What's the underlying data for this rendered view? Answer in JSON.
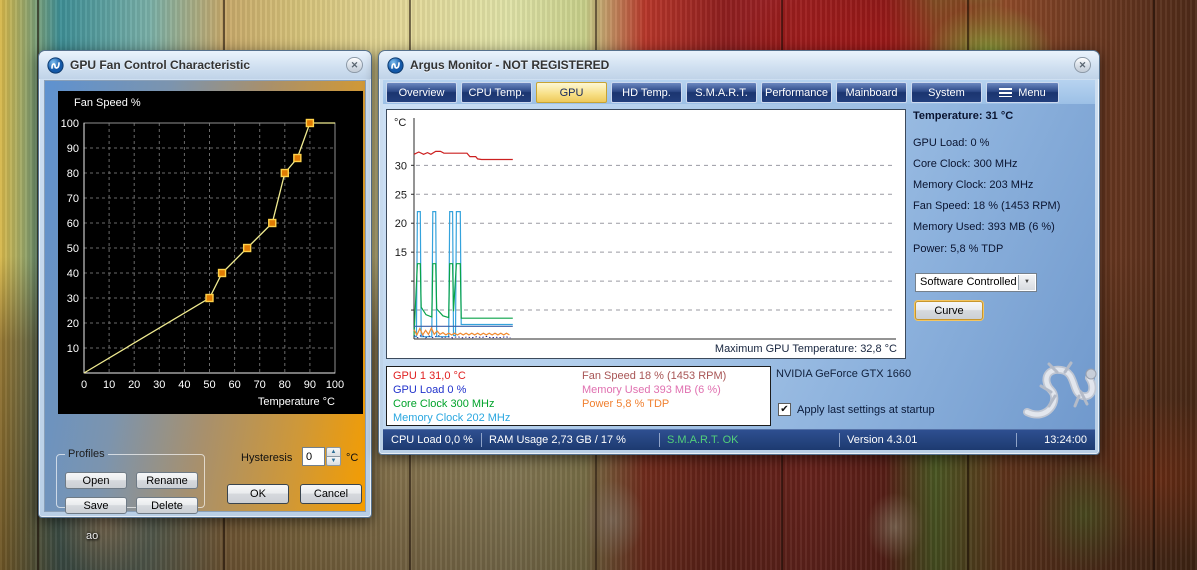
{
  "desktop": {
    "icon_label": "ao"
  },
  "fan_dialog": {
    "title": "GPU Fan Control Characteristic",
    "profiles": {
      "legend": "Profiles",
      "buttons": [
        "Open",
        "Rename",
        "Save",
        "Delete"
      ]
    },
    "hysteresis": {
      "label": "Hysteresis",
      "value": "0",
      "unit": "°C"
    },
    "ok_label": "OK",
    "cancel_label": "Cancel"
  },
  "argus": {
    "title": "Argus Monitor - NOT REGISTERED",
    "tabs": [
      "Overview",
      "CPU Temp.",
      "GPU",
      "HD Temp.",
      "S.M.A.R.T.",
      "Performance",
      "Mainboard",
      "System",
      "Menu"
    ],
    "active_tab": "GPU",
    "info": {
      "rows": [
        "Temperature: 31 °C",
        "GPU Load: 0 %",
        "Core Clock: 300 MHz",
        "Memory Clock: 203 MHz",
        "Fan Speed: 18 % (1453 RPM)",
        "Memory Used: 393 MB (6 %)",
        "Power: 5,8 % TDP"
      ]
    },
    "fan_mode": {
      "value": "Software Controlled"
    },
    "curve_button": "Curve",
    "legend": {
      "col1": [
        {
          "text": "GPU 1 31,0 °C",
          "color": "#e02020"
        },
        {
          "text": "GPU Load 0 %",
          "color": "#2233cc"
        },
        {
          "text": "Core Clock 300 MHz",
          "color": "#00a32a"
        },
        {
          "text": "Memory Clock 202 MHz",
          "color": "#2aa7e0"
        }
      ],
      "col2": [
        {
          "text": "Fan Speed 18 %  (1453 RPM)",
          "color": "#a85555"
        },
        {
          "text": "Memory Used 393 MB  (6 %)",
          "color": "#e070b0"
        },
        {
          "text": "Power 5,8 % TDP",
          "color": "#f08030"
        }
      ]
    },
    "gpu_name": "NVIDIA GeForce GTX 1660",
    "startup_checkbox": {
      "checked": true,
      "label": "Apply last settings at startup"
    },
    "statusbar": {
      "items": [
        "CPU Load 0,0 %",
        "RAM Usage 2,73 GB / 17 %",
        "S.M.A.R.T. OK",
        "Version 4.3.01"
      ],
      "time": "13:24:00"
    }
  },
  "chart_data": [
    {
      "type": "line",
      "title": "GPU fan control characteristic",
      "xlabel": "Temperature °C",
      "ylabel": "Fan Speed %",
      "xlim": [
        0,
        100
      ],
      "ylim": [
        0,
        100
      ],
      "x_ticks": [
        0,
        10,
        20,
        30,
        40,
        50,
        60,
        70,
        80,
        90,
        100
      ],
      "y_ticks": [
        100,
        90,
        80,
        70,
        60,
        50,
        40,
        30,
        20,
        10
      ],
      "grid": true,
      "points": [
        [
          0,
          0
        ],
        [
          50,
          30
        ],
        [
          55,
          40
        ],
        [
          65,
          50
        ],
        [
          75,
          60
        ],
        [
          80,
          80
        ],
        [
          85,
          86
        ],
        [
          90,
          100
        ],
        [
          100,
          100
        ]
      ],
      "marker_points": [
        [
          50,
          30
        ],
        [
          55,
          40
        ],
        [
          65,
          50
        ],
        [
          75,
          60
        ],
        [
          80,
          80
        ],
        [
          85,
          86
        ],
        [
          90,
          100
        ]
      ],
      "line_color": "#f0eb90",
      "marker_fill": "#e07c04",
      "marker_stroke": "#ffd24a"
    },
    {
      "type": "line",
      "title": "GPU history",
      "ylabel": "°C",
      "ylim": [
        0,
        38
      ],
      "gridlines": [
        5,
        10,
        15,
        20,
        25,
        30
      ],
      "y_tick_labels": [
        30,
        25,
        20,
        15
      ],
      "note": "Maximum GPU Temperature: 32,8 °C",
      "x_unit": "percent_of_window",
      "series": [
        {
          "name": "GPU 1 Temperature",
          "color": "#cc2020",
          "points": [
            [
              0,
              31.9
            ],
            [
              1,
              32.3
            ],
            [
              2,
              31.9
            ],
            [
              2.8,
              32.2
            ],
            [
              3.5,
              31.9
            ],
            [
              4.5,
              32.4
            ],
            [
              5.5,
              32.4
            ],
            [
              6.2,
              32.1
            ],
            [
              8,
              32.1
            ],
            [
              11,
              32.1
            ],
            [
              11.6,
              31.5
            ],
            [
              12.8,
              31.5
            ],
            [
              13.2,
              31.1
            ],
            [
              14,
              31.0
            ],
            [
              20.5,
              31.0
            ]
          ]
        },
        {
          "name": "Memory Clock",
          "color": "#35a3dc",
          "points": [
            [
              0,
              0.4
            ],
            [
              0.5,
              0.4
            ],
            [
              0.7,
              22
            ],
            [
              1.3,
              22
            ],
            [
              1.5,
              0.4
            ],
            [
              3.7,
              0.4
            ],
            [
              3.9,
              22
            ],
            [
              4.5,
              22
            ],
            [
              4.7,
              0.4
            ],
            [
              7.2,
              0.4
            ],
            [
              7.4,
              22
            ],
            [
              8.0,
              22
            ],
            [
              8.2,
              0.6
            ],
            [
              8.6,
              0.6
            ],
            [
              8.8,
              22
            ],
            [
              9.6,
              22
            ],
            [
              9.8,
              2.5
            ],
            [
              20.5,
              2.5
            ]
          ]
        },
        {
          "name": "Core Clock",
          "color": "#0aa34a",
          "points": [
            [
              0,
              0.5
            ],
            [
              0.7,
              13
            ],
            [
              1.3,
              13
            ],
            [
              1.5,
              5.5
            ],
            [
              2.5,
              4.2
            ],
            [
              3.7,
              3.8
            ],
            [
              3.9,
              13
            ],
            [
              4.5,
              13
            ],
            [
              4.7,
              5.2
            ],
            [
              6,
              4.0
            ],
            [
              7.2,
              3.7
            ],
            [
              7.4,
              13
            ],
            [
              8.0,
              13
            ],
            [
              8.2,
              4.8
            ],
            [
              8.8,
              13
            ],
            [
              9.6,
              13
            ],
            [
              9.8,
              3.6
            ],
            [
              20.5,
              3.6
            ]
          ]
        },
        {
          "name": "GPU Load",
          "color": "#3a5fa8",
          "points": [
            [
              0,
              2.2
            ],
            [
              20.5,
              2.2
            ]
          ]
        },
        {
          "name": "Power",
          "color": "#f08a30",
          "points": [
            [
              0,
              1.6
            ],
            [
              0.6,
              0.7
            ],
            [
              1.2,
              1.8
            ],
            [
              1.8,
              0.7
            ],
            [
              2.4,
              1.5
            ],
            [
              3,
              0.8
            ],
            [
              3.6,
              1.9
            ],
            [
              4.2,
              0.8
            ],
            [
              4.8,
              1.4
            ],
            [
              5.4,
              0.8
            ],
            [
              6,
              1.1
            ],
            [
              6.6,
              0.7
            ],
            [
              7.2,
              1.0
            ],
            [
              7.8,
              0.7
            ],
            [
              8.4,
              1.0
            ],
            [
              9,
              0.7
            ],
            [
              9.6,
              1.0
            ],
            [
              10.2,
              0.7
            ],
            [
              10.8,
              1.0
            ],
            [
              11.4,
              0.7
            ],
            [
              12,
              1.0
            ],
            [
              12.6,
              0.7
            ],
            [
              13.2,
              1.0
            ],
            [
              13.8,
              0.7
            ],
            [
              14.4,
              1.0
            ],
            [
              15,
              0.7
            ],
            [
              15.6,
              1.0
            ],
            [
              16.2,
              0.7
            ],
            [
              16.8,
              1.0
            ],
            [
              17.4,
              0.7
            ],
            [
              18,
              1.0
            ],
            [
              18.6,
              0.7
            ],
            [
              19.2,
              1.0
            ],
            [
              19.8,
              0.7
            ]
          ]
        },
        {
          "name": "Memory Used",
          "color": "#24248c",
          "dotted": true,
          "points": [
            [
              0,
              0.6
            ],
            [
              0.8,
              0.2
            ],
            [
              1.6,
              0.7
            ],
            [
              2.4,
              0.2
            ],
            [
              3.2,
              0.5
            ],
            [
              4,
              0.2
            ],
            [
              5,
              0.6
            ],
            [
              6,
              0.2
            ],
            [
              7,
              0.4
            ],
            [
              8,
              0.2
            ],
            [
              9,
              0.4
            ],
            [
              10,
              0.2
            ],
            [
              11,
              0.35
            ],
            [
              12,
              0.2
            ],
            [
              13,
              0.4
            ],
            [
              14,
              0.25
            ],
            [
              15,
              0.45
            ],
            [
              16,
              0.2
            ],
            [
              17,
              0.3
            ],
            [
              18,
              0.25
            ],
            [
              19,
              0.4
            ],
            [
              20,
              0.2
            ]
          ]
        }
      ]
    }
  ]
}
